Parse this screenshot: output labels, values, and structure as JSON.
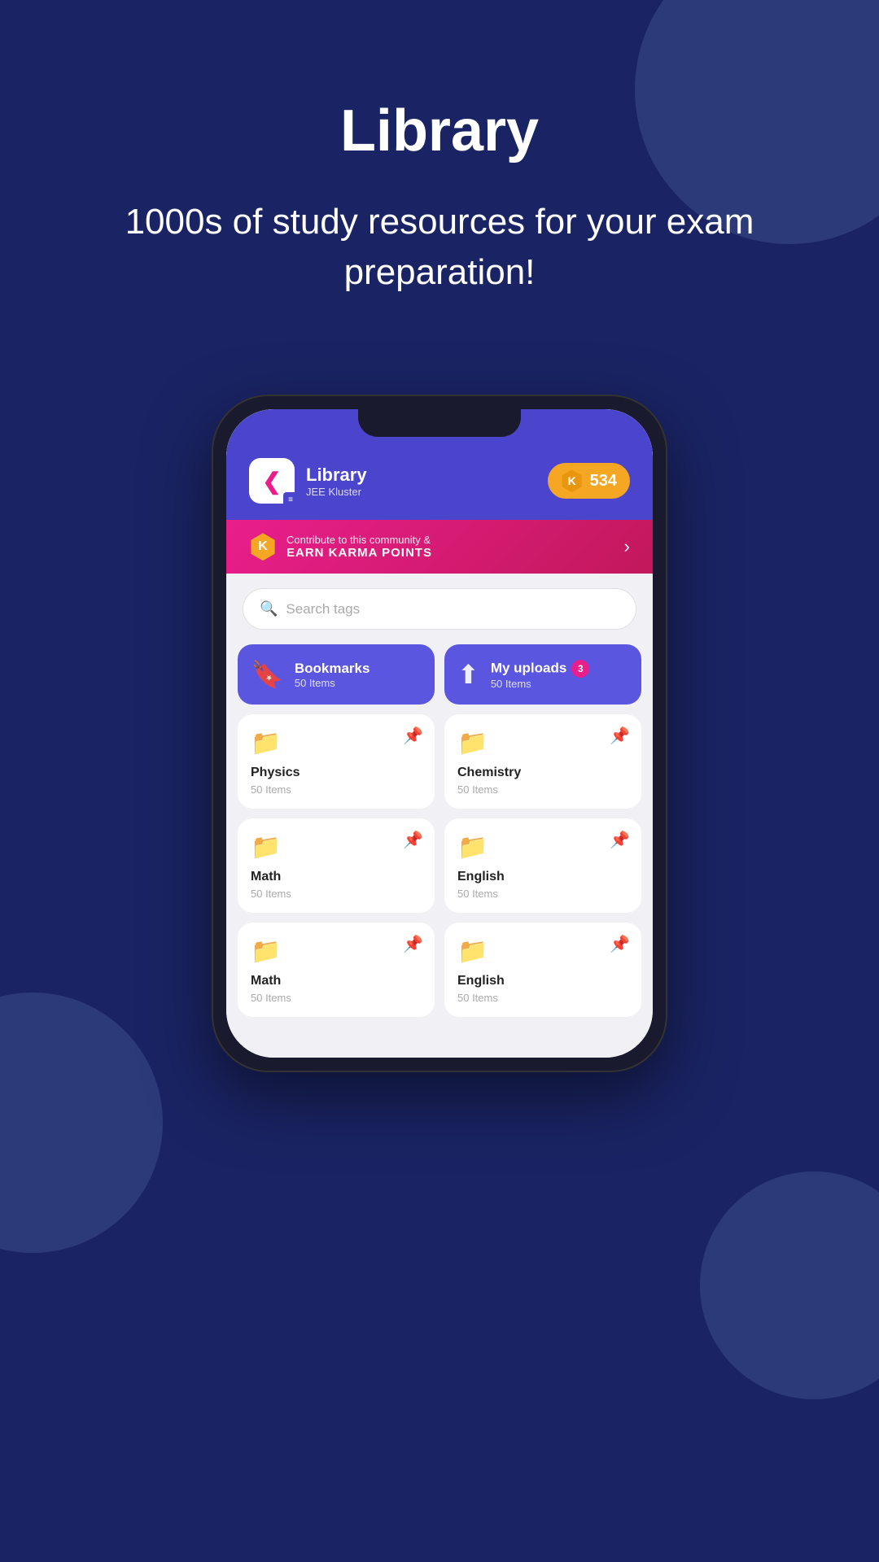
{
  "page": {
    "background_color": "#1a2464"
  },
  "hero": {
    "title": "Library",
    "subtitle": "1000s of study resources for your exam preparation!"
  },
  "app": {
    "logo_letter": "K",
    "title": "Library",
    "subtitle": "JEE Kluster",
    "karma_label": "K",
    "karma_value": "534",
    "banner": {
      "contribute_text": "Contribute to this community &",
      "earn_text": "EARN KARMA POINTS"
    },
    "search": {
      "placeholder": "Search tags"
    },
    "quick_cards": [
      {
        "label": "Bookmarks",
        "count": "50 Items",
        "icon": "bookmark"
      },
      {
        "label": "My uploads",
        "count": "50 Items",
        "badge": "3",
        "icon": "upload"
      }
    ],
    "subjects": [
      {
        "name": "Physics",
        "count": "50 Items"
      },
      {
        "name": "Chemistry",
        "count": "50 Items"
      },
      {
        "name": "Math",
        "count": "50 Items"
      },
      {
        "name": "English",
        "count": "50 Items"
      },
      {
        "name": "Math",
        "count": "50 Items"
      },
      {
        "name": "English",
        "count": "50 Items"
      }
    ]
  }
}
